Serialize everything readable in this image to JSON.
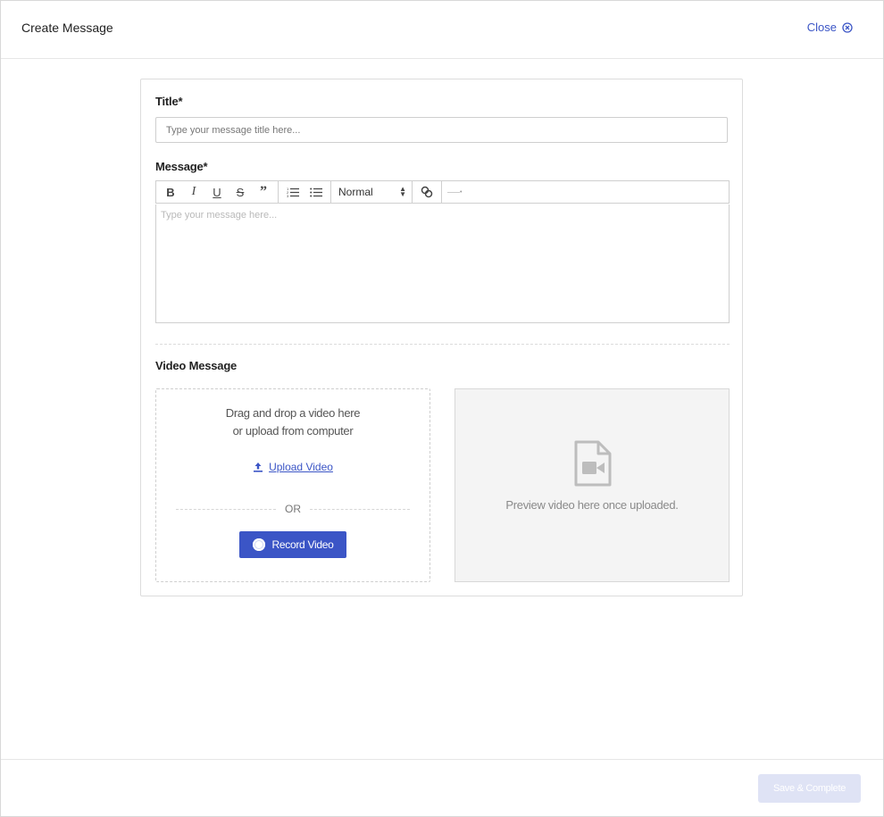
{
  "header": {
    "title": "Create Message",
    "close_label": "Close"
  },
  "form": {
    "title_label": "Title*",
    "title_placeholder": "Type your message title here...",
    "message_label": "Message*",
    "message_placeholder": "Type your message here...",
    "toolbar": {
      "bold": "B",
      "italic": "I",
      "underline": "U",
      "strike": "S",
      "quote": "”",
      "format_select_value": "Normal",
      "extra_label": "——•"
    },
    "video_label": "Video Message"
  },
  "upload": {
    "drop_line1": "Drag and drop a video here",
    "drop_line2": "or upload from computer",
    "upload_label": "Upload Video",
    "or_label": "OR",
    "record_label": "Record Video"
  },
  "preview": {
    "text": "Preview video here once uploaded."
  },
  "footer": {
    "save_label": "Save & Complete"
  },
  "colors": {
    "accent": "#3b55c6",
    "disabled_button": "#dfe3f5",
    "preview_bg": "#f4f4f4"
  },
  "icons": {
    "close": "close-circle-icon",
    "upload": "upload-icon",
    "record": "record-dot-icon",
    "preview": "video-file-icon"
  }
}
